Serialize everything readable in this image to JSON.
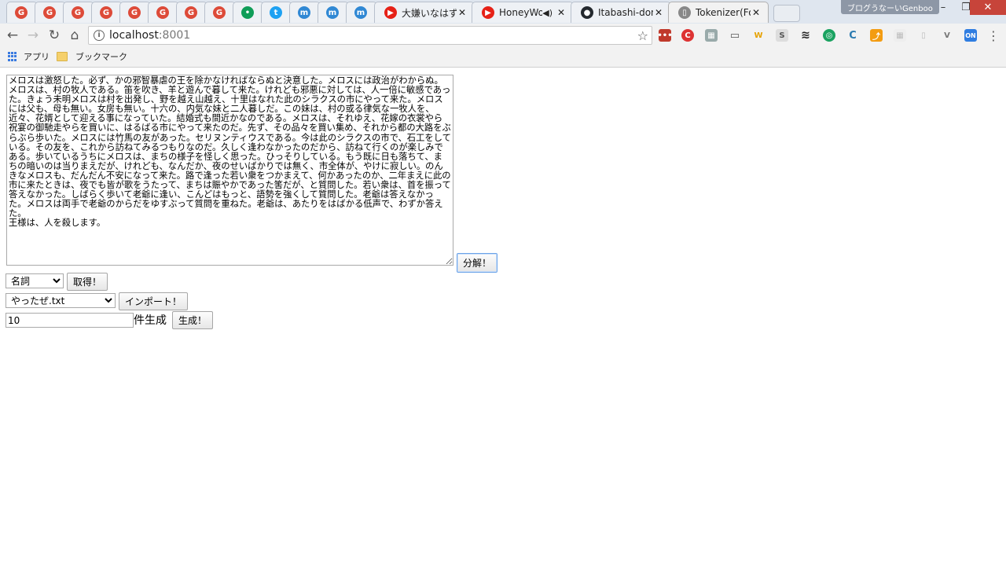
{
  "tabs": [
    {
      "pinned": true,
      "icon": "G",
      "icon_name": "google-plus-icon",
      "color": "#dd4b39"
    },
    {
      "pinned": true,
      "icon": "G",
      "icon_name": "google-plus-icon",
      "color": "#dd4b39"
    },
    {
      "pinned": true,
      "icon": "G",
      "icon_name": "google-plus-icon",
      "color": "#dd4b39"
    },
    {
      "pinned": true,
      "icon": "G",
      "icon_name": "google-plus-icon",
      "color": "#dd4b39"
    },
    {
      "pinned": true,
      "icon": "G",
      "icon_name": "google-plus-icon",
      "color": "#dd4b39"
    },
    {
      "pinned": true,
      "icon": "G",
      "icon_name": "google-plus-icon",
      "color": "#dd4b39"
    },
    {
      "pinned": true,
      "icon": "G",
      "icon_name": "google-plus-icon",
      "color": "#dd4b39"
    },
    {
      "pinned": true,
      "icon": "G",
      "icon_name": "google-plus-icon",
      "color": "#dd4b39"
    },
    {
      "pinned": true,
      "icon": "•",
      "icon_name": "hangouts-icon",
      "color": "#0f9d58"
    },
    {
      "pinned": true,
      "icon": "t",
      "icon_name": "twitter-icon",
      "color": "#1da1f2"
    },
    {
      "pinned": true,
      "icon": "m",
      "icon_name": "mastodon-icon",
      "color": "#3088d4"
    },
    {
      "pinned": true,
      "icon": "m",
      "icon_name": "mastodon-icon",
      "color": "#3088d4"
    },
    {
      "pinned": true,
      "icon": "m",
      "icon_name": "mastodon-icon",
      "color": "#3088d4"
    },
    {
      "pinned": false,
      "icon": "▶",
      "icon_name": "youtube-icon",
      "color": "#e62117",
      "title": "大嫌いなはずだっ"
    },
    {
      "pinned": false,
      "icon": "▶",
      "icon_name": "youtube-icon",
      "color": "#e62117",
      "title": "HoneyWor"
    },
    {
      "pinned": false,
      "icon": "●",
      "icon_name": "github-icon",
      "color": "#24292e",
      "title": "Itabashi-don/"
    },
    {
      "pinned": false,
      "icon": "▯",
      "icon_name": "page-icon",
      "color": "#888888",
      "title": "Tokenizer(For"
    }
  ],
  "profile_name": "ブログうなーいGenboo",
  "url": {
    "host": "localhost",
    "port": ":8001"
  },
  "bookmarks": {
    "apps": "アプリ",
    "folder": "ブックマーク"
  },
  "source_text": "メロスは激怒した。必ず、かの邪智暴虐の王を除かなければならぬと決意した。メロスには政治がわからぬ。メロスは、村の牧人である。笛を吹き、羊と遊んで暮して来た。けれども邪悪に対しては、人一倍に敏感であった。きょう未明メロスは村を出発し、野を越え山越え、十里はなれた此のシラクスの市にやって来た。メロスには父も、母も無い。女房も無い。十六の、内気な妹と二人暮しだ。この妹は、村の或る律気な一牧人を、近々、花婿として迎える事になっていた。結婚式も間近かなのである。メロスは、それゆえ、花嫁の衣裳やら祝宴の御馳走やらを買いに、はるばる市にやって来たのだ。先ず、その品々を買い集め、それから都の大路をぶらぶら歩いた。メロスには竹馬の友があった。セリヌンティウスである。今は此のシラクスの市で、石工をしている。その友を、これから訪ねてみるつもりなのだ。久しく逢わなかったのだから、訪ねて行くのが楽しみである。歩いているうちにメロスは、まちの様子を怪しく思った。ひっそりしている。もう既に日も落ちて、まちの暗いのは当りまえだが、けれども、なんだか、夜のせいばかりでは無く、市全体が、やけに寂しい。のんきなメロスも、だんだん不安になって来た。路で逢った若い衆をつかまえて、何かあったのか、二年まえに此の市に来たときは、夜でも皆が歌をうたって、まちは賑やかであった筈だが、と質問した。若い衆は、首を振って答えなかった。しばらく歩いて老爺に逢い、こんどはもっと、語勢を強くして質問した。老爺は答えなかった。メロスは両手で老爺のからだをゆすぶって質問を重ねた。老爺は、あたりをはばかる低声で、わずか答えた。\n王様は、人を殺します。",
  "buttons": {
    "analyze": "分解！",
    "fetch": "取得！",
    "import": "インポート！",
    "generate": "生成！"
  },
  "pos_select": {
    "selected": "名詞"
  },
  "file_select": {
    "selected": "やったぜ.txt"
  },
  "count_input": {
    "value": "10"
  },
  "count_suffix": "件生成"
}
